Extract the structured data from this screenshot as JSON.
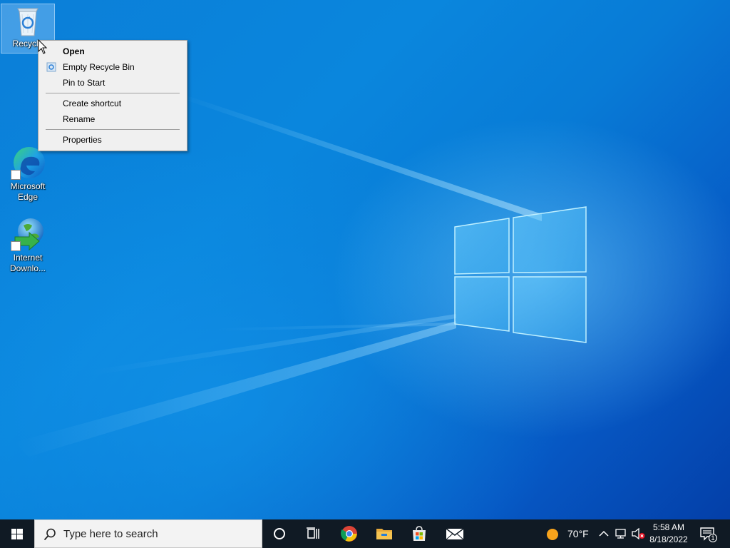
{
  "desktop": {
    "icons": [
      {
        "label": "Recycle Bin",
        "shown_label": "Recycle"
      },
      {
        "label_line1": "Microsoft",
        "label_line2": "Edge"
      },
      {
        "label_line1": "Internet",
        "label_line2": "Downlo..."
      }
    ]
  },
  "context_menu": {
    "items": [
      {
        "label": "Open"
      },
      {
        "label": "Empty Recycle Bin"
      },
      {
        "label": "Pin to Start"
      },
      {
        "label": "Create shortcut"
      },
      {
        "label": "Rename"
      },
      {
        "label": "Properties"
      }
    ]
  },
  "taskbar": {
    "search_placeholder": "Type here to search",
    "pinned_apps": [
      "cortana-icon",
      "task-view-icon",
      "chrome-icon",
      "file-explorer-icon",
      "store-icon",
      "mail-icon"
    ],
    "weather_temp": "70°F",
    "clock_time": "5:58 AM",
    "clock_date": "8/18/2022",
    "notification_count": "1"
  },
  "colors": {
    "taskbar": "#101a24",
    "menu_bg": "#f0f0f0",
    "wallpaper_accent": "#0a78d4"
  }
}
